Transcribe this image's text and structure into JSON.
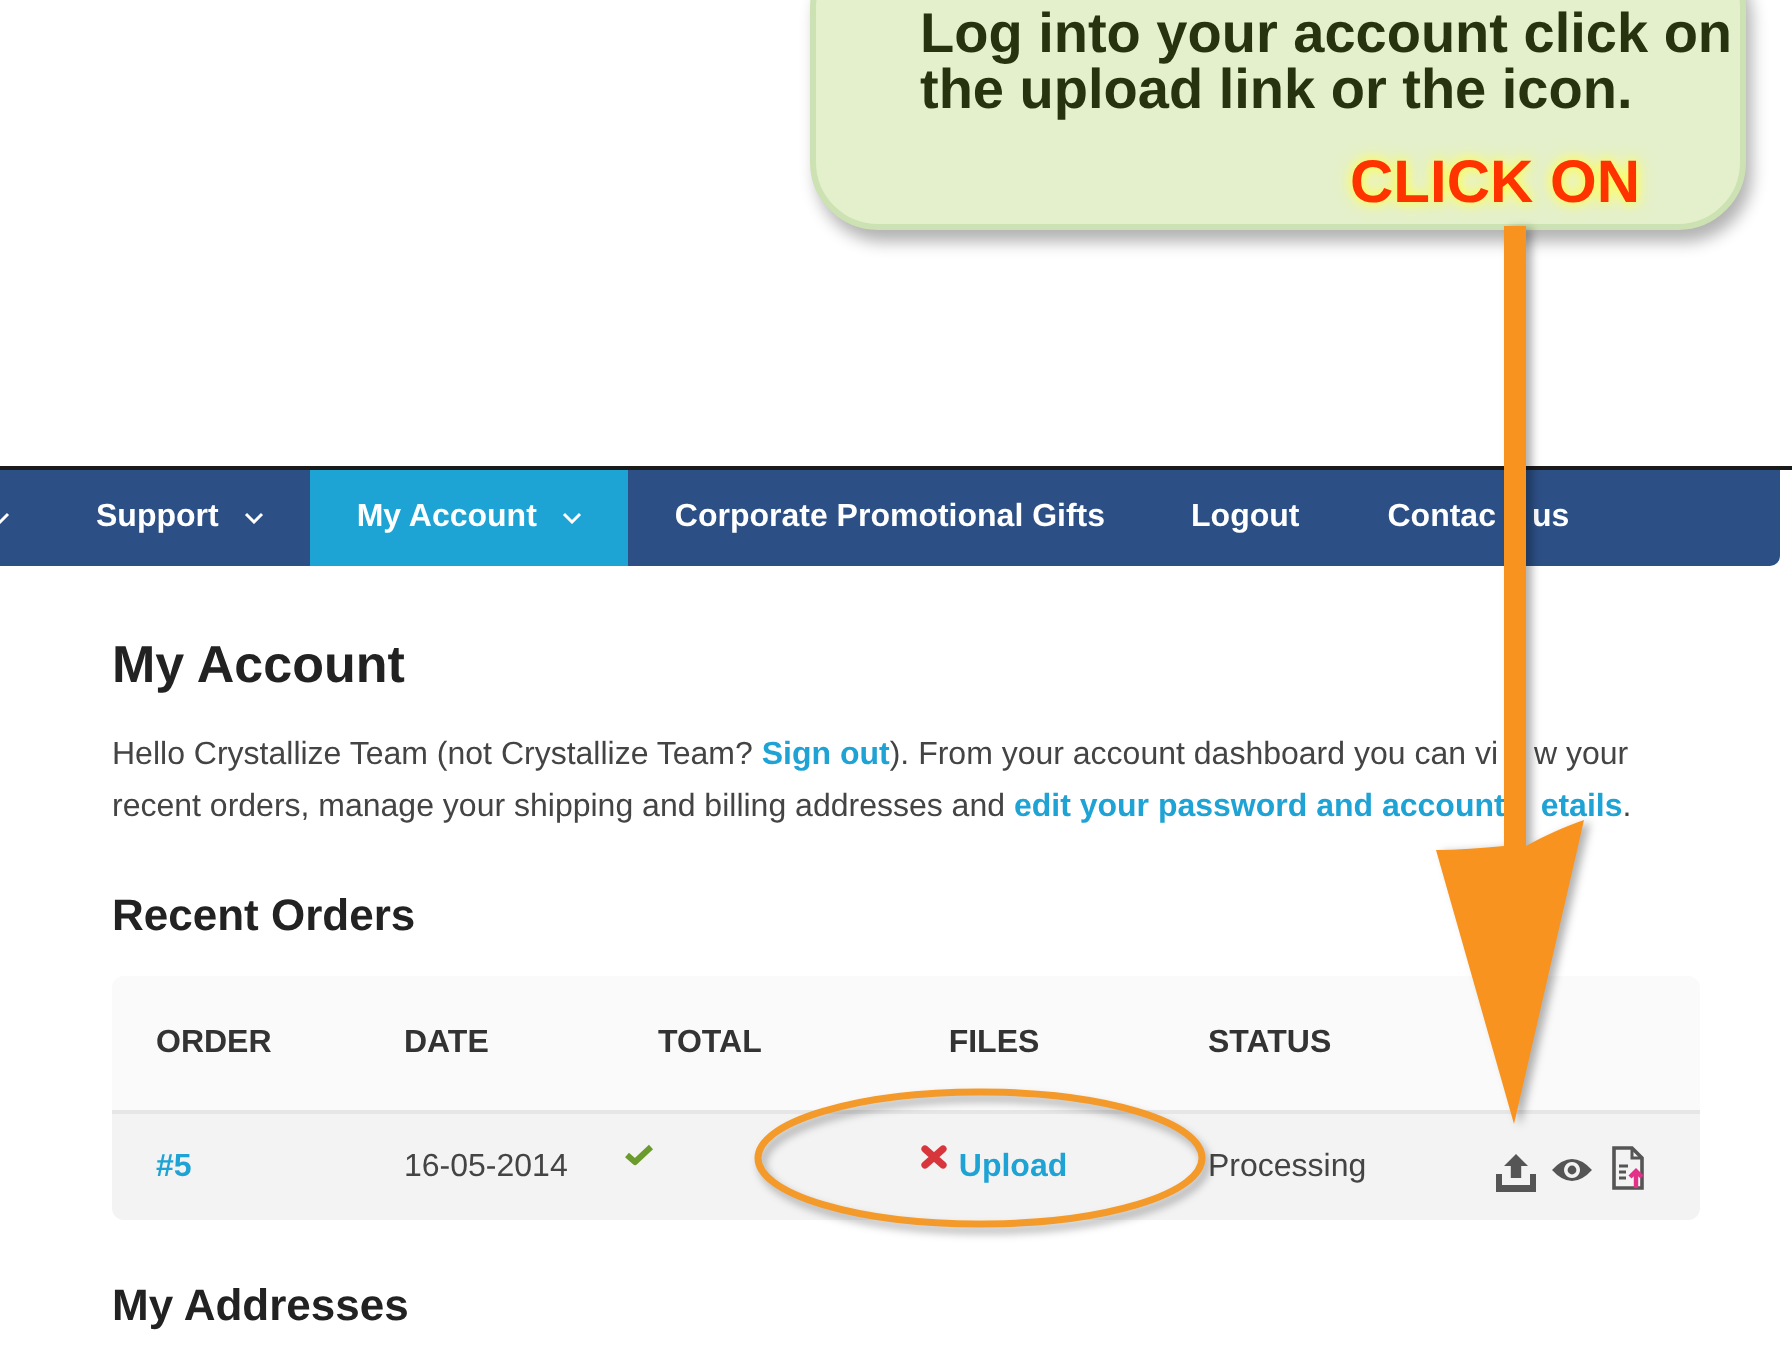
{
  "callout": {
    "text": "Log into your account click on the upload link or the icon.",
    "action_label": "CLICK ON"
  },
  "nav": {
    "leading_caret": true,
    "items": [
      {
        "label": "Support",
        "has_menu": true,
        "selected": false
      },
      {
        "label": "My Account",
        "has_menu": true,
        "selected": true
      },
      {
        "label": "Corporate Promotional Gifts",
        "has_menu": false,
        "selected": false
      },
      {
        "label": "Logout",
        "has_menu": false,
        "selected": false
      },
      {
        "label_parts": [
          "Contac",
          "us"
        ],
        "has_menu": false,
        "selected": false
      }
    ]
  },
  "account": {
    "title": "My Account",
    "intro": [
      {
        "kind": "text",
        "text": "Hello Crystallize Team (not Crystallize Team? "
      },
      {
        "kind": "link",
        "text": "Sign out"
      },
      {
        "kind": "text",
        "parts": [
          "). From your account dashboard you can vi",
          "w your recent orders, manage your shipping and billing addresses and "
        ]
      },
      {
        "kind": "link",
        "parts": [
          "edit your password and account",
          "etails"
        ]
      },
      {
        "kind": "text",
        "text": "."
      }
    ]
  },
  "recent_orders": {
    "title": "Recent Orders",
    "columns": [
      "ORDER",
      "DATE",
      "TOTAL",
      "FILES",
      "STATUS"
    ],
    "rows": [
      {
        "order": "#5",
        "date": "16-05-2014",
        "total_checked": true,
        "files": {
          "link": "Upload",
          "missing": true
        },
        "status": "Processing"
      }
    ]
  },
  "addresses": {
    "title": "My Addresses"
  }
}
